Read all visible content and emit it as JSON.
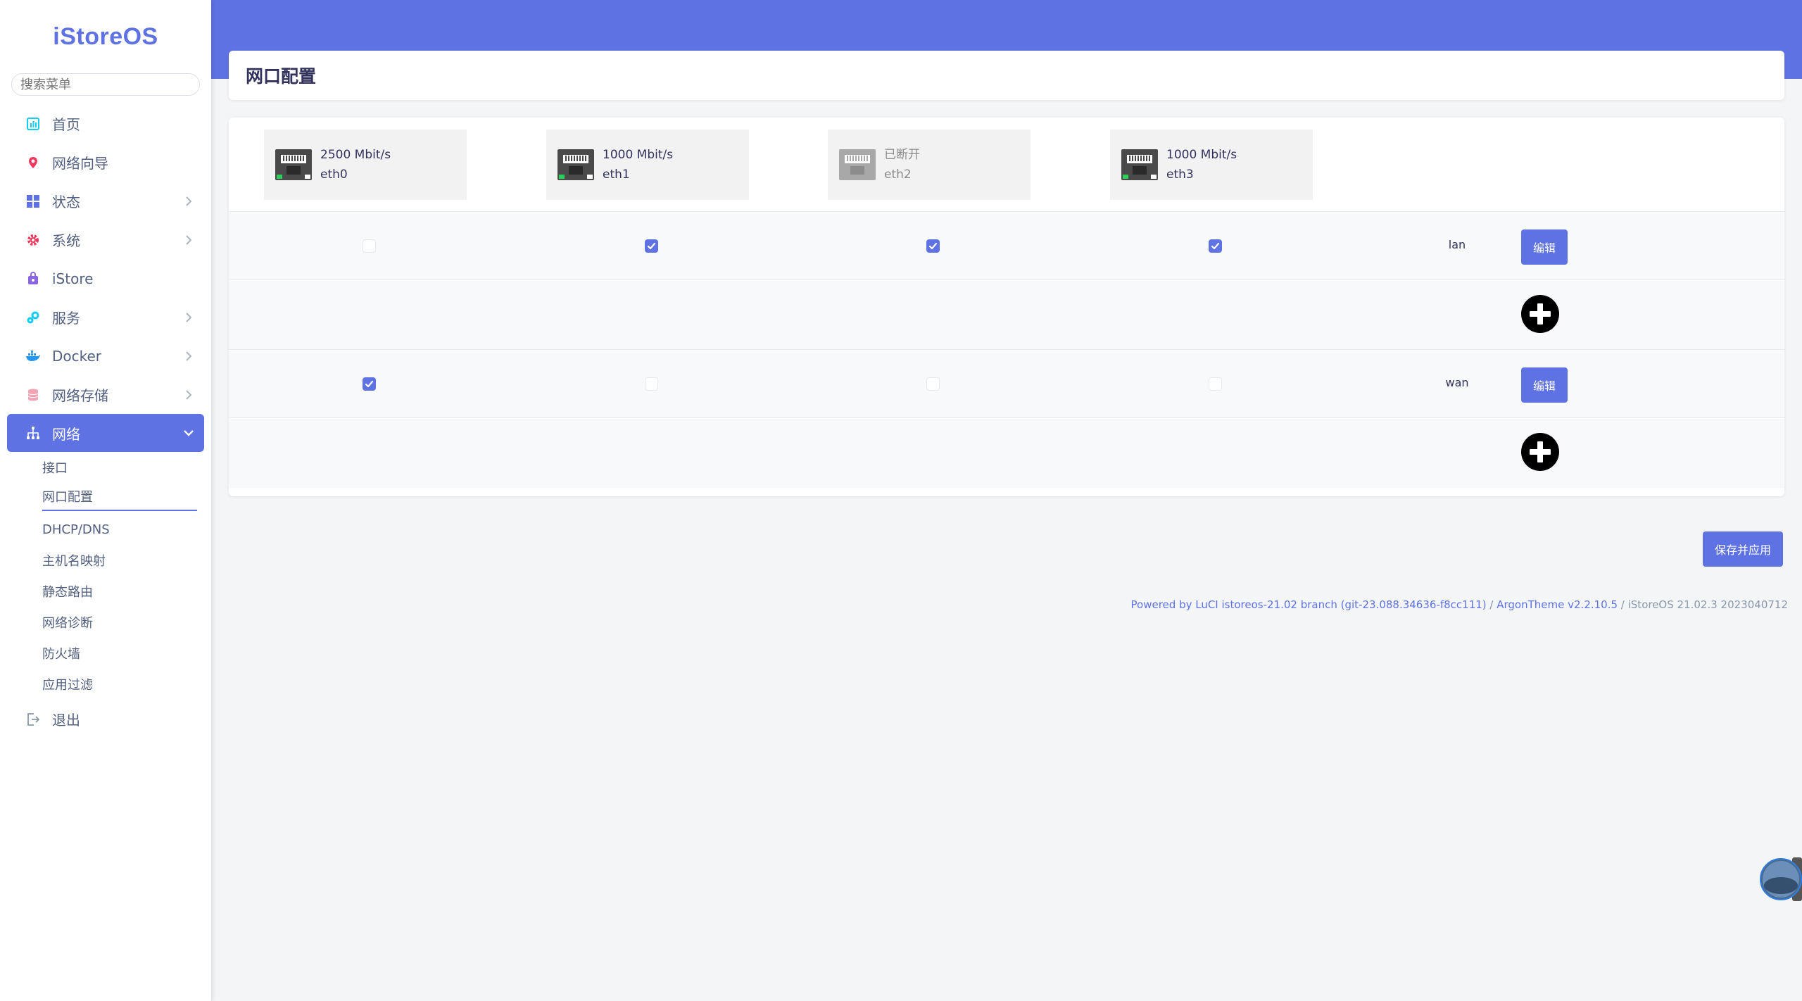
{
  "app": {
    "brand": "iStoreOS",
    "accent": "#5e72e4"
  },
  "sidebar": {
    "search_placeholder": "搜索菜单",
    "items": [
      {
        "label": "首页",
        "icon": "home-icon"
      },
      {
        "label": "网络向导",
        "icon": "network-wizard-icon"
      },
      {
        "label": "状态",
        "icon": "status-grid-icon"
      },
      {
        "label": "系统",
        "icon": "system-gear-icon"
      },
      {
        "label": "iStore",
        "icon": "store-bag-icon"
      },
      {
        "label": "服务",
        "icon": "services-gears-icon"
      },
      {
        "label": "Docker",
        "icon": "docker-icon"
      },
      {
        "label": "网络存储",
        "icon": "storage-database-icon"
      },
      {
        "label": "网络",
        "icon": "network-tree-icon"
      }
    ],
    "network_sub": [
      {
        "label": "接口"
      },
      {
        "label": "网口配置"
      },
      {
        "label": "DHCP/DNS"
      },
      {
        "label": "主机名映射"
      },
      {
        "label": "静态路由"
      },
      {
        "label": "网络诊断"
      },
      {
        "label": "防火墙"
      },
      {
        "label": "应用过滤"
      }
    ],
    "logout": "退出"
  },
  "page": {
    "title": "网口配置"
  },
  "ports": [
    {
      "speed": "2500 Mbit/s",
      "name": "eth0",
      "status": "connected"
    },
    {
      "speed": "1000 Mbit/s",
      "name": "eth1",
      "status": "connected"
    },
    {
      "speed": "已断开",
      "name": "eth2",
      "status": "disconnected"
    },
    {
      "speed": "1000 Mbit/s",
      "name": "eth3",
      "status": "connected"
    }
  ],
  "zones": [
    {
      "name": "lan",
      "members": [
        false,
        true,
        true,
        true
      ],
      "edit_label": "编辑"
    },
    {
      "name": "wan",
      "members": [
        true,
        false,
        false,
        false
      ],
      "edit_label": "编辑"
    }
  ],
  "actions": {
    "save_apply": "保存并应用"
  },
  "footer": {
    "powered": "Powered by LuCI istoreos-21.02 branch (git-23.088.34636-f8cc111)",
    "sep": " / ",
    "theme": "ArgonTheme v2.2.10.5",
    "version": " / iStoreOS 21.02.3 2023040712"
  }
}
